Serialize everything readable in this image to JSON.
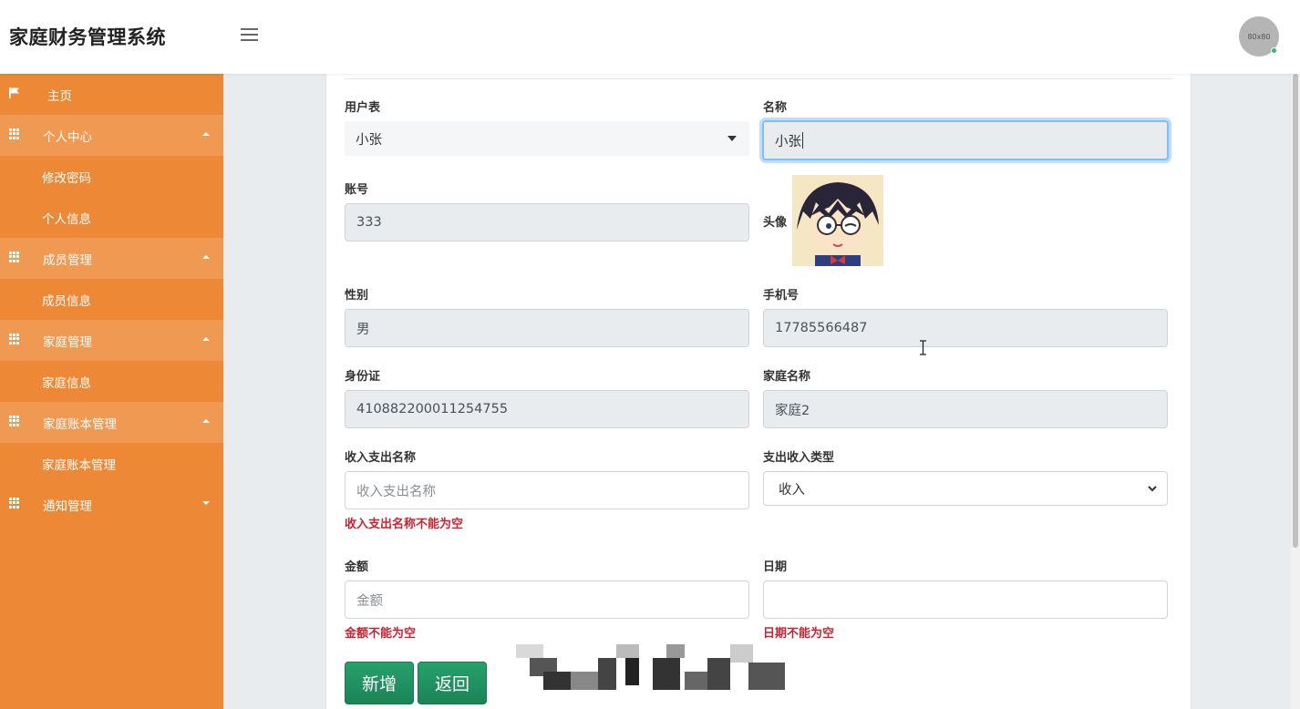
{
  "header": {
    "title": "家庭财务管理系统",
    "avatar_text": "80x80"
  },
  "colors": {
    "sidebar": "#ed8836",
    "sidebar_group": "#ef9953",
    "error": "#c82333",
    "button": "#1b8458"
  },
  "sidebar": {
    "home": "主页",
    "groups": [
      {
        "label": "个人中心",
        "items": [
          "修改密码",
          "个人信息"
        ],
        "expanded": true
      },
      {
        "label": "成员管理",
        "items": [
          "成员信息"
        ],
        "expanded": true
      },
      {
        "label": "家庭管理",
        "items": [
          "家庭信息"
        ],
        "expanded": true
      },
      {
        "label": "家庭账本管理",
        "items": [
          "家庭账本管理"
        ],
        "expanded": true
      },
      {
        "label": "通知管理",
        "items": [],
        "expanded": false
      }
    ]
  },
  "form": {
    "user_table": {
      "label": "用户表",
      "value": "小张"
    },
    "name": {
      "label": "名称",
      "value": "小张"
    },
    "account": {
      "label": "账号",
      "value": "333"
    },
    "avatar": {
      "label": "头像"
    },
    "gender": {
      "label": "性别",
      "value": "男"
    },
    "phone": {
      "label": "手机号",
      "value": "17785566487"
    },
    "id_card": {
      "label": "身份证",
      "value": "410882200011254755"
    },
    "family_name": {
      "label": "家庭名称",
      "value": "家庭2"
    },
    "income_name": {
      "label": "收入支出名称",
      "placeholder": "收入支出名称",
      "error": "收入支出名称不能为空"
    },
    "type": {
      "label": "支出收入类型",
      "value": "收入"
    },
    "amount": {
      "label": "金额",
      "placeholder": "金额",
      "error": "金额不能为空"
    },
    "date": {
      "label": "日期",
      "value": "",
      "error": "日期不能为空"
    }
  },
  "buttons": {
    "add": "新增",
    "back": "返回"
  }
}
